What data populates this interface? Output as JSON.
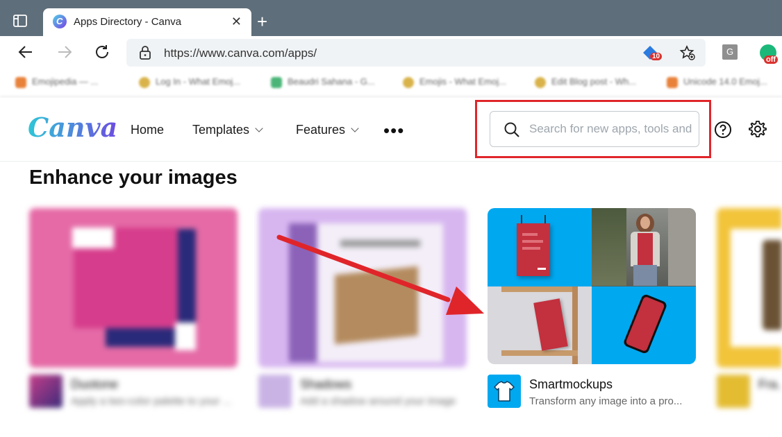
{
  "browser": {
    "tab_title": "Apps Directory - Canva",
    "url": "https://www.canva.com/apps/",
    "extension_badges": {
      "ext1": "10",
      "ext2": "off"
    },
    "ext_g_label": "G"
  },
  "bookmarks": [
    {
      "label": "Emojipedia — ...",
      "color": "#e8823a"
    },
    {
      "label": "Log In - What Emoj...",
      "color": "#d9b34a"
    },
    {
      "label": "Beaudri Sahana - G...",
      "color": "#4bb578"
    },
    {
      "label": "Emojis - What Emoj...",
      "color": "#d9b34a"
    },
    {
      "label": "Edit Blog post - Wh...",
      "color": "#d9b34a"
    },
    {
      "label": "Unicode 14.0 Emoj...",
      "color": "#e8823a"
    }
  ],
  "canva": {
    "logo": "Canva",
    "nav": {
      "home": "Home",
      "templates": "Templates",
      "features": "Features",
      "more": "•••"
    },
    "search": {
      "placeholder": "Search for new apps, tools and more"
    }
  },
  "section": {
    "title": "Enhance your images"
  },
  "cards": [
    {
      "name": "Duotone",
      "description": "Apply a two-color palette to your ..."
    },
    {
      "name": "Shadows",
      "description": "Add a shadow around your image"
    },
    {
      "name": "Smartmockups",
      "description": "Transform any image into a pro..."
    },
    {
      "name": "Fra...",
      "description": ""
    }
  ],
  "colors": {
    "highlight": "#e0252a",
    "accent_blue": "#00a8f0",
    "mock_red": "#c3303e"
  }
}
